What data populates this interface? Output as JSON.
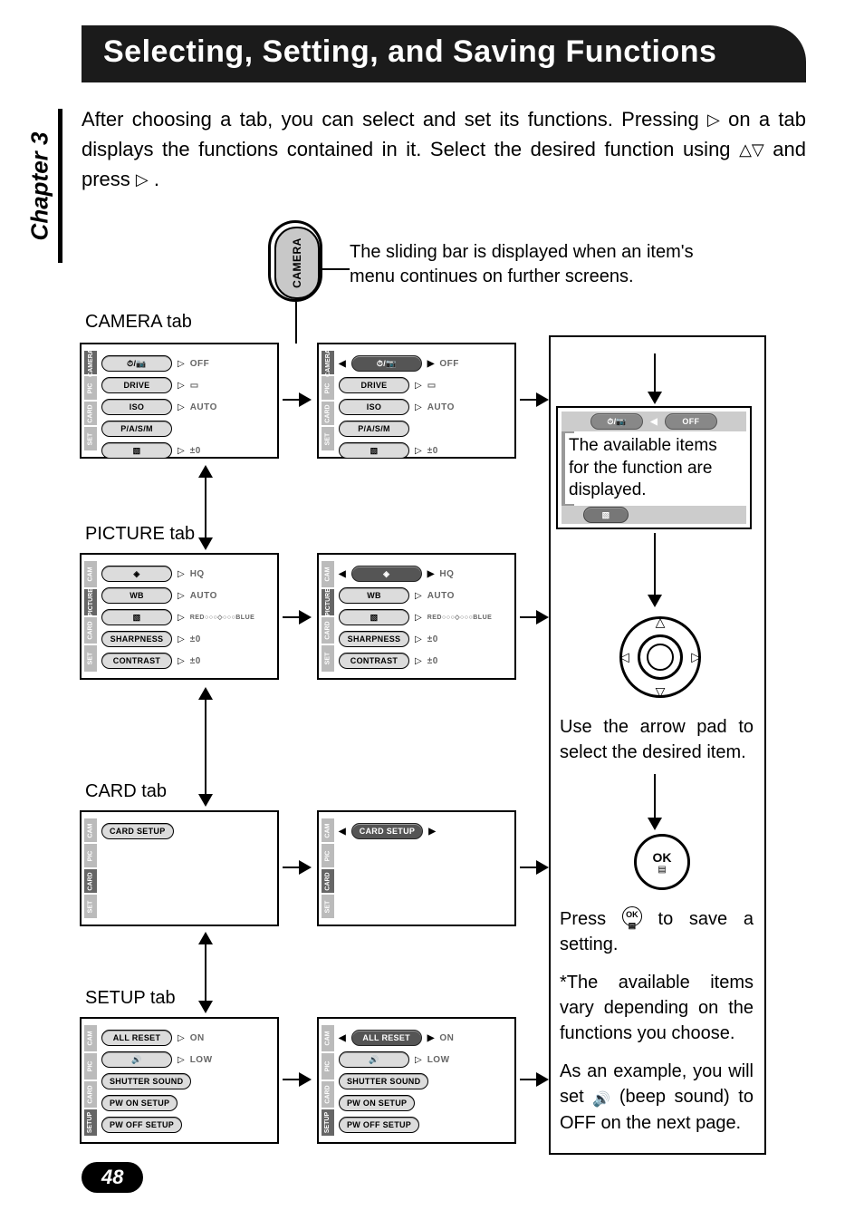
{
  "chapter_label": "Chapter 3",
  "title": "Selecting, Setting, and Saving Functions",
  "intro_1": "After choosing a tab, you can select and set its functions. Pressing ",
  "intro_2": " on a tab displays the functions contained in it. Select the desired function using ",
  "intro_3": " and press ",
  "intro_4": ".",
  "zoom_tab_label": "CAMERA",
  "zoom_note": "The sliding bar is displayed when an item's menu continues on further screens.",
  "labels": {
    "camera": "CAMERA tab",
    "picture": "PICTURE tab",
    "card": "CARD tab",
    "setup": "SETUP tab"
  },
  "side_tabs": [
    "CAMERA",
    "PIC",
    "CARD",
    "SET"
  ],
  "side_tabs_pic": [
    "CAM",
    "PICTURE",
    "CARD",
    "SET"
  ],
  "side_tabs_card": [
    "CAM",
    "PIC",
    "CARD",
    "SET"
  ],
  "side_tabs_setup": [
    "CAM",
    "PIC",
    "CARD",
    "SETUP"
  ],
  "camera_items": [
    {
      "name": "SELF/REMOTE",
      "icon": "⏱/📷",
      "value": "OFF"
    },
    {
      "name": "DRIVE",
      "icon": "DRIVE",
      "value": "▭"
    },
    {
      "name": "ISO",
      "icon": "ISO",
      "value": "AUTO"
    },
    {
      "name": "P/A/S/M",
      "icon": "P/A/S/M",
      "value": ""
    },
    {
      "name": "EXPCOMP",
      "icon": "▧",
      "value": "±0"
    }
  ],
  "picture_items": [
    {
      "name": "QUALITY",
      "icon": "◈",
      "value": "HQ"
    },
    {
      "name": "WB",
      "icon": "WB",
      "value": "AUTO"
    },
    {
      "name": "COLORBAL",
      "icon": "▧",
      "value": "RED○○○◇○○○BLUE"
    },
    {
      "name": "SHARPNESS",
      "icon": "SHARPNESS",
      "value": "±0"
    },
    {
      "name": "CONTRAST",
      "icon": "CONTRAST",
      "value": "±0"
    }
  ],
  "card_items": [
    {
      "name": "CARD SETUP",
      "icon": "CARD SETUP",
      "value": ""
    }
  ],
  "setup_items": [
    {
      "name": "ALL RESET",
      "icon": "ALL RESET",
      "value": "ON"
    },
    {
      "name": "BEEP",
      "icon": "🔊",
      "value": "LOW"
    },
    {
      "name": "SHUTTER SOUND",
      "icon": "SHUTTER SOUND",
      "value": ""
    },
    {
      "name": "PW ON SETUP",
      "icon": "PW ON SETUP",
      "value": ""
    },
    {
      "name": "PW OFF SETUP",
      "icon": "PW OFF SETUP",
      "value": ""
    }
  ],
  "detail_head_value": "OFF",
  "avail_text": "The available items for the function are displayed.",
  "arrowpad_text": "Use the arrow pad to select the desired item.",
  "ok_label": "OK",
  "press_ok_1": "Press ",
  "press_ok_2": " to save a setting.",
  "vary_text": "*The available items vary depending on the functions you choose.",
  "example_1": "As an example, you will set ",
  "example_2": " (beep sound) to OFF on the next page.",
  "page_number": "48"
}
